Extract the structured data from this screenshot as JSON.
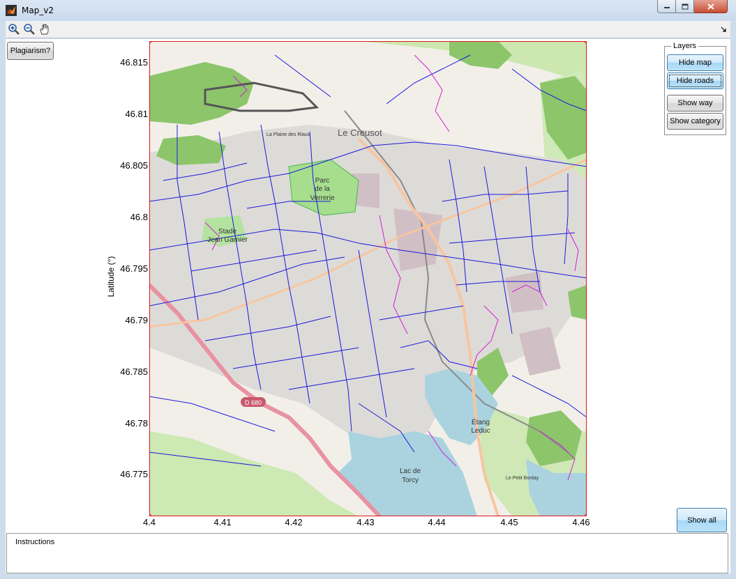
{
  "window": {
    "title": "Map_v2",
    "controls": {
      "minimize": "–",
      "maximize": "□",
      "close": "✕"
    }
  },
  "toolbar": {
    "tools": [
      {
        "name": "zoom-in",
        "icon": "zoom-in-icon"
      },
      {
        "name": "zoom-out",
        "icon": "zoom-out-icon"
      },
      {
        "name": "pan",
        "icon": "hand-pan-icon"
      }
    ]
  },
  "buttons": {
    "plagiarism": "Plagiarism?",
    "show_all": "Show all"
  },
  "layers": {
    "title": "Layers",
    "hide_map": "Hide map",
    "hide_roads": "Hide roads",
    "show_way": "Show way",
    "show_category": "Show category"
  },
  "axes": {
    "ylabel": "Latitude (°)",
    "y_ticks": [
      "46.815",
      "46.81",
      "46.805",
      "46.8",
      "46.795",
      "46.79",
      "46.785",
      "46.78",
      "46.775"
    ],
    "x_ticks": [
      "4.4",
      "4.41",
      "4.42",
      "4.43",
      "4.44",
      "4.45",
      "4.46"
    ],
    "x_range": [
      4.4,
      4.46
    ],
    "y_range": [
      46.771,
      46.817
    ]
  },
  "map_labels": {
    "le_creusot": "Le Creusot",
    "parc_l1": "Parc",
    "parc_l2": "de la",
    "parc_l3": "Verrerie",
    "stade_l1": "Stade",
    "stade_l2": "Jean Garnier",
    "etang_l1": "Étang",
    "etang_l2": "Leduc",
    "lac_l1": "Lac de",
    "lac_l2": "Torcy",
    "road_d680": "D 680",
    "le_petit_bonlay": "Le Petit Bonlay",
    "les_riaux": "La Plaine des Riaux"
  },
  "instructions": {
    "label": "Instructions"
  },
  "colors": {
    "roads_blue": "#1a1adb",
    "paths_magenta": "#d21fd2",
    "forest_green": "#79b55b",
    "park_green": "#a6de8e",
    "water": "#aad3df",
    "urban_gray": "#d9d7d4",
    "axis_red": "#e0171b",
    "button_blue": "#a7d8f6"
  }
}
